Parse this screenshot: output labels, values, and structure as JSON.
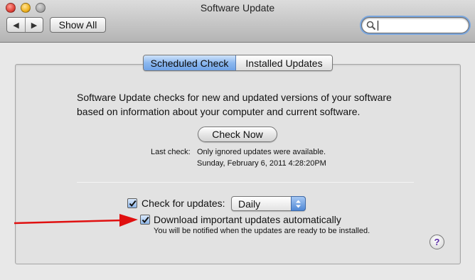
{
  "window": {
    "title": "Software Update",
    "traffic_lights": [
      "close",
      "minimize",
      "zoom"
    ]
  },
  "toolbar": {
    "back_icon": "◀",
    "forward_icon": "▶",
    "show_all_label": "Show All",
    "search": {
      "value": "",
      "placeholder": ""
    }
  },
  "tabs": [
    {
      "label": "Scheduled Check",
      "selected": true
    },
    {
      "label": "Installed Updates",
      "selected": false
    }
  ],
  "content": {
    "description_line1": "Software Update checks for new and updated versions of your software",
    "description_line2": "based on information about your computer and current software.",
    "check_now_label": "Check Now",
    "last_check_label": "Last check:",
    "last_check_status": "Only ignored updates were available.",
    "last_check_date": "Sunday, February 6, 2011 4:28:20PM",
    "check_for_updates": {
      "label": "Check for updates:",
      "checked": true
    },
    "frequency": {
      "selected": "Daily"
    },
    "download_automatically": {
      "label": "Download important updates automatically",
      "checked": true
    },
    "download_note": "You will be notified when the updates are ready to be installed.",
    "help_label": "?"
  },
  "colors": {
    "accent_blue": "#6fa2e6",
    "annotation_arrow": "#e01010",
    "help_glyph": "#5b2ca8"
  }
}
